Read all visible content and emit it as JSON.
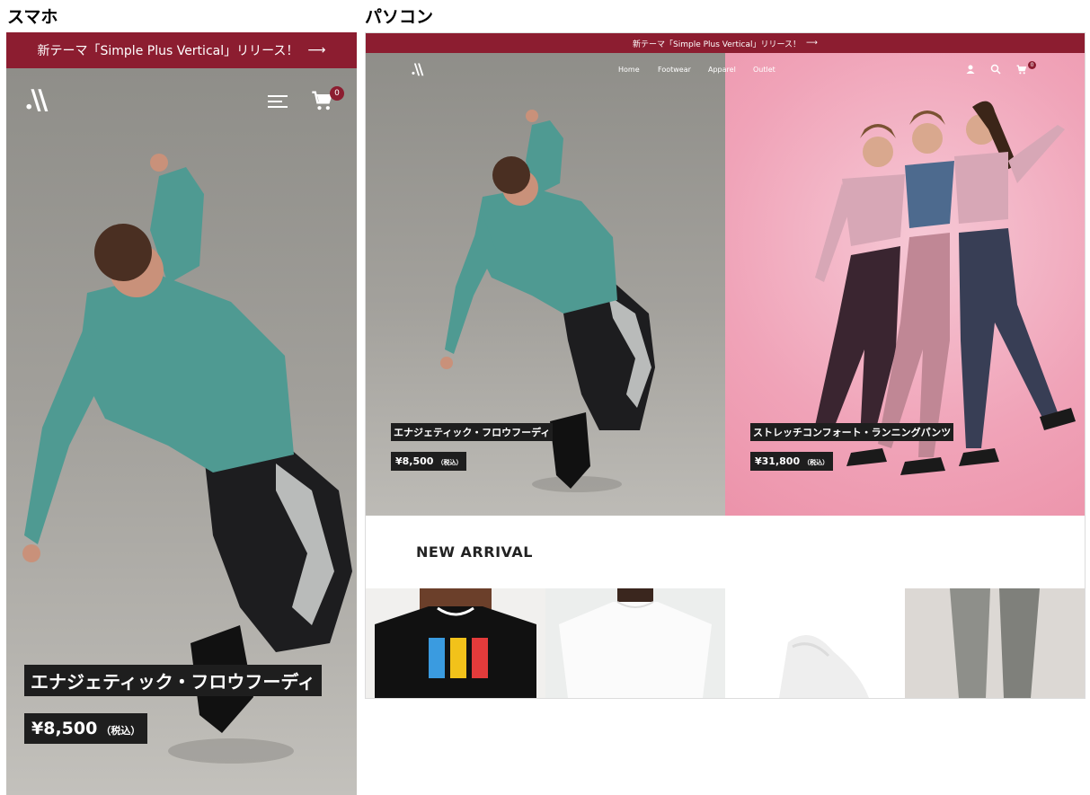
{
  "headings": {
    "smartphone": "スマホ",
    "pc": "パソコン"
  },
  "announcement": {
    "text": "新テーマ「Simple Plus Vertical」リリース！",
    "arrow": "⟶"
  },
  "brand": {
    "logo": ".\\\\"
  },
  "nav": {
    "items": [
      "Home",
      "Footwear",
      "Apparel",
      "Outlet"
    ]
  },
  "cart": {
    "count": "0"
  },
  "icons": {
    "menu": "menu-icon",
    "cart": "cart-icon",
    "account": "user-icon",
    "search": "search-icon"
  },
  "products": [
    {
      "name": "エナジェティック・フロウフーディ",
      "price": "¥8,500",
      "tax": "（税込）"
    },
    {
      "name": "ストレッチコンフォート・ランニングパンツ",
      "price": "¥31,800",
      "tax": "（税込）"
    }
  ],
  "section": {
    "title": "NEW ARRIVAL"
  },
  "colors": {
    "accent": "#8c1d30",
    "label_bg": "#1e1e1e",
    "pink": "#f0a3b8"
  }
}
